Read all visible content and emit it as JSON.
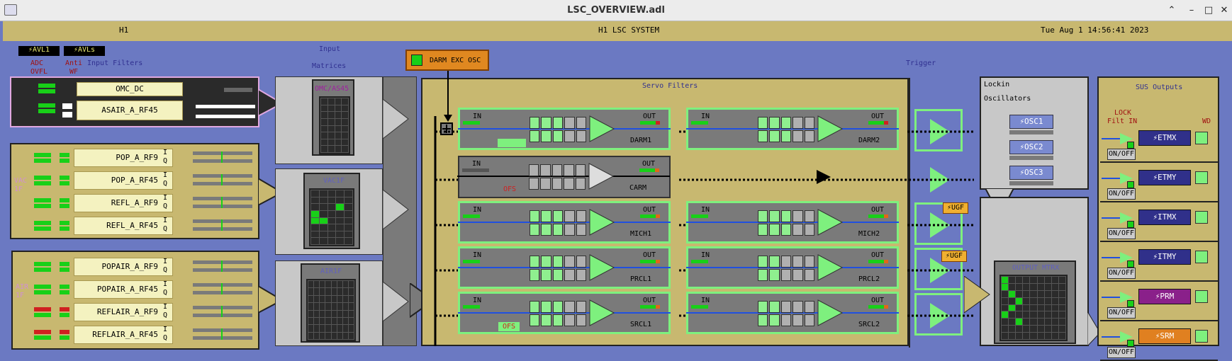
{
  "window": {
    "title": "LSC_OVERVIEW.adl"
  },
  "header": {
    "left": "H1",
    "center": "H1 LSC SYSTEM",
    "right": "Tue Aug  1 14:56:41 2023"
  },
  "top_labels": {
    "hwwd1": "⚡AVL1",
    "hwwd2": "⚡AVLs",
    "adc": "ADC",
    "ovfl": "OVFL",
    "anti": "Anti",
    "wf": "WF",
    "input_filters": "Input Filters",
    "input": "Input",
    "matrices": "Matrices",
    "darm_exc": "DARM EXC OSC",
    "servo_filters": "Servo Filters",
    "trigger": "Trigger",
    "lockin": "Lockin",
    "oscillators": "Oscillators",
    "sus_outputs": "SUS Outputs",
    "lock": "LOCK",
    "filt_in": "Filt IN",
    "wd": "WD"
  },
  "omc_group": {
    "channels": [
      "OMC_DC",
      "ASAIR_A_RF45"
    ]
  },
  "vac_group": {
    "label": "VAC 1F",
    "channels": [
      "POP_A_RF9",
      "POP_A_RF45",
      "REFL_A_RF9",
      "REFL_A_RF45"
    ]
  },
  "air_group": {
    "label": "AIR 1F",
    "channels": [
      "POPAIR_A_RF9",
      "POPAIR_A_RF45",
      "REFLAIR_A_RF9",
      "REFLAIR_A_RF45"
    ]
  },
  "iq": {
    "i": "I",
    "q": "Q"
  },
  "matrices": [
    "OMC/AS45",
    "VAC1F",
    "AIR1F"
  ],
  "servo": {
    "in": "IN",
    "out": "OUT",
    "ofs": "OFS",
    "left": [
      "DARM1",
      "CARM",
      "MICH1",
      "PRCL1",
      "SRCL1"
    ],
    "right": [
      "DARM2",
      "",
      "MICH2",
      "PRCL2",
      "SRCL2"
    ]
  },
  "ugf": "⚡UGF",
  "osc": [
    "⚡OSC1",
    "⚡OSC2",
    "⚡OSC3"
  ],
  "output_matrix": "OUTPUT MTRX",
  "sus": [
    {
      "label": "⚡ETMX",
      "color": "#30308a"
    },
    {
      "label": "⚡ETMY",
      "color": "#30308a"
    },
    {
      "label": "⚡ITMX",
      "color": "#30308a"
    },
    {
      "label": "⚡ITMY",
      "color": "#30308a"
    },
    {
      "label": "⚡PRM",
      "color": "#8a208a"
    },
    {
      "label": "⚡SRM",
      "color": "#e08020"
    }
  ],
  "onoff": "ON/OFF"
}
